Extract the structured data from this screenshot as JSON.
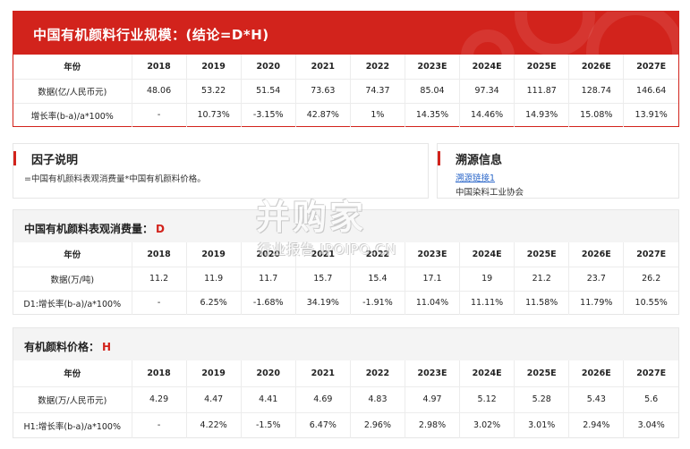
{
  "main": {
    "title": "中国有机颜料行业规模：(结论=D*H)",
    "header_label": "年份",
    "years": [
      "2018",
      "2019",
      "2020",
      "2021",
      "2022",
      "2023E",
      "2024E",
      "2025E",
      "2026E",
      "2027E"
    ],
    "rows": [
      {
        "label": "数据(亿/人民币元)",
        "values": [
          "48.06",
          "53.22",
          "51.54",
          "73.63",
          "74.37",
          "85.04",
          "97.34",
          "111.87",
          "128.74",
          "146.64"
        ]
      },
      {
        "label": "增长率(b-a)/a*100%",
        "values": [
          "-",
          "10.73%",
          "-3.15%",
          "42.87%",
          "1%",
          "14.35%",
          "14.46%",
          "14.93%",
          "15.08%",
          "13.91%"
        ]
      }
    ]
  },
  "factor": {
    "title": "因子说明",
    "text": "=中国有机颜料表观消费量*中国有机颜料价格。"
  },
  "source": {
    "title": "溯源信息",
    "link": "溯源链接1",
    "org": "中国染料工业协会"
  },
  "d_section": {
    "title": "中国有机颜料表观消费量：",
    "var": "D",
    "header_label": "年份",
    "years": [
      "2018",
      "2019",
      "2020",
      "2021",
      "2022",
      "2023E",
      "2024E",
      "2025E",
      "2026E",
      "2027E"
    ],
    "rows": [
      {
        "label": "数据(万/吨)",
        "values": [
          "11.2",
          "11.9",
          "11.7",
          "15.7",
          "15.4",
          "17.1",
          "19",
          "21.2",
          "23.7",
          "26.2"
        ]
      },
      {
        "label": "D1:增长率(b-a)/a*100%",
        "values": [
          "-",
          "6.25%",
          "-1.68%",
          "34.19%",
          "-1.91%",
          "11.04%",
          "11.11%",
          "11.58%",
          "11.79%",
          "10.55%"
        ]
      }
    ]
  },
  "h_section": {
    "title": "有机颜料价格：",
    "var": "H",
    "header_label": "年份",
    "years": [
      "2018",
      "2019",
      "2020",
      "2021",
      "2022",
      "2023E",
      "2024E",
      "2025E",
      "2026E",
      "2027E"
    ],
    "rows": [
      {
        "label": "数据(万/人民币元)",
        "values": [
          "4.29",
          "4.47",
          "4.41",
          "4.69",
          "4.83",
          "4.97",
          "5.12",
          "5.28",
          "5.43",
          "5.6"
        ]
      },
      {
        "label": "H1:增长率(b-a)/a*100%",
        "values": [
          "-",
          "4.22%",
          "-1.5%",
          "6.47%",
          "2.96%",
          "2.98%",
          "3.02%",
          "3.01%",
          "2.94%",
          "3.04%"
        ]
      }
    ]
  },
  "watermark": {
    "main": "并购家",
    "sub": "行业报告 IPOIPO.CN"
  },
  "colors": {
    "accent": "#d2231c",
    "link": "#2a66c9"
  }
}
